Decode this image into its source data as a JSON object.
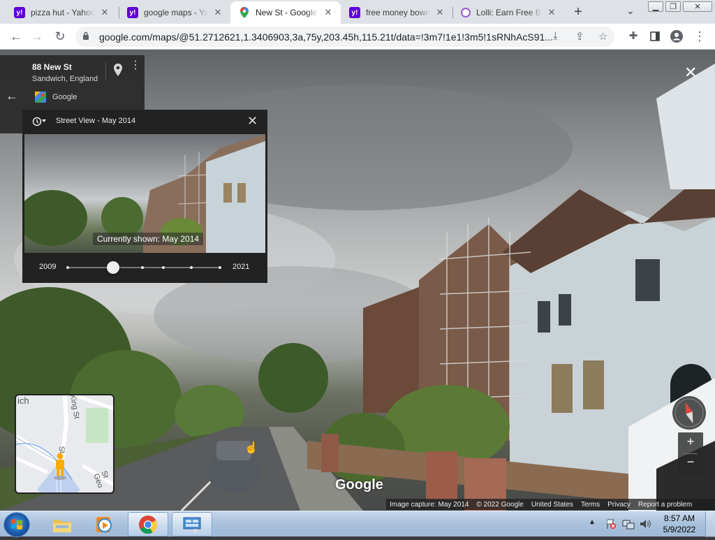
{
  "browser": {
    "tabs": [
      {
        "title": "pizza hut - Yahoo",
        "favicon": "yahoo-icon",
        "active": false
      },
      {
        "title": "google maps - Yahoo",
        "favicon": "yahoo-icon",
        "active": false
      },
      {
        "title": "New St - Google Maps",
        "favicon": "google-maps-icon",
        "active": true
      },
      {
        "title": "free money bowndy",
        "favicon": "yahoo-icon",
        "active": false
      },
      {
        "title": "Lolli: Earn Free Bitcoin",
        "favicon": "lolli-icon",
        "active": false
      }
    ],
    "new_tab_label": "+",
    "url": "google.com/maps/@51.2712621,1.3406903,3a,75y,203.45h,115.21t/data=!3m7!1e1!3m5!1sRNhAcS91..."
  },
  "location_card": {
    "title": "88 New St",
    "subtitle": "Sandwich, England",
    "source": "Google"
  },
  "time_machine": {
    "header": "Street View - May 2014",
    "current_caption": "Currently shown: May 2014",
    "start_year": "2009",
    "end_year": "2021",
    "stops": 6,
    "selected_index": 1
  },
  "minimap": {
    "labels": [
      "ich",
      "King St",
      "St",
      "St Geo"
    ]
  },
  "streetview": {
    "watermark": "Google"
  },
  "zoom": {
    "in_label": "+",
    "out_label": "−"
  },
  "footer": {
    "capture": "Image capture: May 2014",
    "copyright": "© 2022 Google",
    "country": "United States",
    "terms": "Terms",
    "privacy": "Privacy",
    "report": "Report a problem"
  },
  "taskbar": {
    "time": "8:57 AM",
    "date": "5/9/2022"
  },
  "colors": {
    "yahoo": "#6001d2",
    "panel_dark": "#222222",
    "taskbar": "#a9c1dc",
    "compass_red": "#e8453c"
  }
}
